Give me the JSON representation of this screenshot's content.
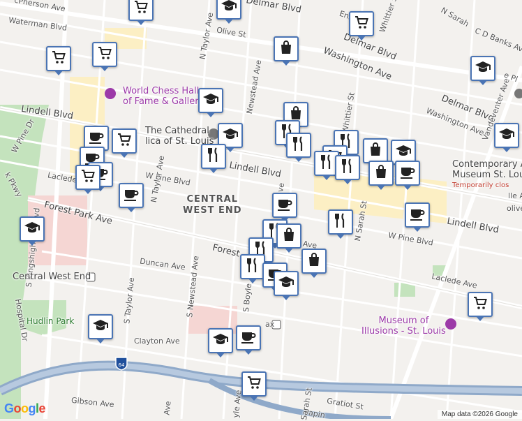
{
  "map": {
    "attribution": "Map data ©2026 Google",
    "logo_text": "Google",
    "neighborhood": [
      "CENTRAL",
      "WEST END"
    ],
    "labels": {
      "mcpherson": "cPherson Ave",
      "waterman": "Waterman Blvd",
      "olive": "Olive St",
      "n_taylor_top": "N Taylor Ave",
      "delmar_top": "Delmar Blvd",
      "washington_top": "Washington Ave",
      "newstead_n": "Newstead Ave",
      "delmar_right": "Delmar Blvd",
      "washington_right": "Washington Ave",
      "cd_banks": "C D Banks Ave",
      "vandeventer": "Vandeventer Ave",
      "lindell_left": "Lindell Blvd",
      "lindell_mid": "Lindell Blvd",
      "lindell_right": "Lindell Blvd",
      "w_pine_left": "W Pine Blvd",
      "w_pine_right": "W Pine Blvd",
      "laclede_left": "Laclede",
      "laclede_right": "Laclede Ave",
      "forest_park": "Forest Park Ave",
      "forest_mid": "Forest",
      "kingshighway": "S Kingshighway Blvd",
      "park_pkwy": "k Pkwy",
      "w_pine_dr": "W Pine Dr",
      "duncan": "Duncan Ave",
      "s_taylor": "S Taylor Ave",
      "s_newstead": "S Newstead Ave",
      "s_boyle": "S Boyle",
      "n_taylor_mid": "N Taylor Ave",
      "boyle_ave": "Boyle Ave",
      "sarah_st_n": "N Sarah St",
      "whittier": "Whittier St",
      "whittier_top": "Whittier St",
      "clayton": "Clayton Ave",
      "gibson": "Gibson Ave",
      "gratiot": "Gratiot St",
      "papin": "Papin",
      "sarah_st": "Sarah St",
      "hospital_dr": "Hospital Dr",
      "n_sarah_top": "N Sarah",
      "enright": "Enri",
      "pl": "e Pl",
      "lle_ave": "lle Ave",
      "olive_right": "olive",
      "ave_bottom_left": "Ave",
      "boyle_bottom": "yle Ave",
      "ave_bottom": "e Ave",
      "ax": "ax",
      "ave_mid": "Ave",
      "ave_right": "ve"
    },
    "pois": {
      "chess": [
        "World Chess Hall",
        "of Fame & Galleries"
      ],
      "cathedral": [
        "The Cathedral",
        "lica of St. Louis"
      ],
      "museum": [
        "Contemporary A",
        "Museum St. Lou"
      ],
      "museum_status": "Temporarily clos",
      "illusions": [
        "Museum of",
        "Illusions - St. Louis"
      ],
      "cwe_station": "Central West End",
      "hudlin": "Hudlin Park"
    }
  },
  "colors": {
    "marker_border": "#4a74b4",
    "poi_purple": "#9c3aa8",
    "park_green": "#c4e3bd",
    "hospital_pink": "#f5d6d3",
    "highway": "#8fa9c9"
  },
  "markers": [
    {
      "icon": "shopping-cart-icon"
    },
    {
      "icon": "school-icon"
    },
    {
      "icon": "shopping-cart-icon"
    },
    {
      "icon": "shopping-cart-icon"
    },
    {
      "icon": "shopping-cart-icon"
    },
    {
      "icon": "shopping-bag-icon"
    },
    {
      "icon": "school-icon"
    },
    {
      "icon": "school-icon"
    },
    {
      "icon": "shopping-bag-icon"
    },
    {
      "icon": "restaurant-icon"
    },
    {
      "icon": "restaurant-icon"
    },
    {
      "icon": "school-icon"
    },
    {
      "icon": "school-icon"
    },
    {
      "icon": "restaurant-icon"
    },
    {
      "icon": "coffee-icon"
    },
    {
      "icon": "shopping-cart-icon"
    },
    {
      "icon": "restaurant-icon"
    },
    {
      "icon": "shopping-cart-icon"
    },
    {
      "icon": "restaurant-icon"
    },
    {
      "icon": "restaurant-icon"
    },
    {
      "icon": "shopping-bag-icon"
    },
    {
      "icon": "school-icon"
    },
    {
      "icon": "shopping-bag-icon"
    },
    {
      "icon": "coffee-icon"
    },
    {
      "icon": "coffee-icon"
    },
    {
      "icon": "coffee-icon"
    },
    {
      "icon": "restaurant-icon"
    },
    {
      "icon": "coffee-icon"
    },
    {
      "icon": "restaurant-icon"
    },
    {
      "icon": "shopping-bag-icon"
    },
    {
      "icon": "restaurant-icon"
    },
    {
      "icon": "restaurant-icon"
    },
    {
      "icon": "shopping-bag-icon"
    },
    {
      "icon": "coffee-icon"
    },
    {
      "icon": "school-icon"
    },
    {
      "icon": "school-icon"
    },
    {
      "icon": "shopping-cart-icon"
    },
    {
      "icon": "school-icon"
    },
    {
      "icon": "coffee-icon"
    },
    {
      "icon": "school-icon"
    },
    {
      "icon": "shopping-cart-icon"
    }
  ]
}
